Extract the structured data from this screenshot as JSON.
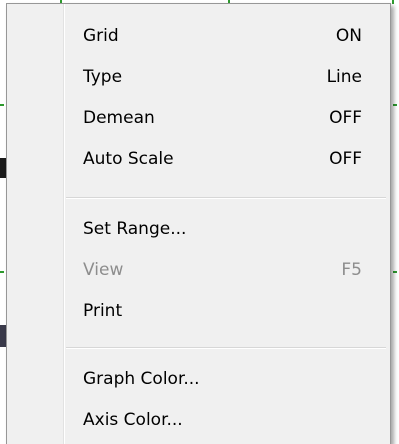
{
  "menu": {
    "items": [
      {
        "label": "Grid",
        "value": "ON",
        "enabled": true
      },
      {
        "label": "Type",
        "value": "Line",
        "enabled": true
      },
      {
        "label": "Demean",
        "value": "OFF",
        "enabled": true
      },
      {
        "label": "Auto Scale",
        "value": "OFF",
        "enabled": true
      },
      {
        "label": "Set Range...",
        "value": "",
        "enabled": true
      },
      {
        "label": "View",
        "value": "F5",
        "enabled": false
      },
      {
        "label": "Print",
        "value": "",
        "enabled": true
      },
      {
        "label": "Graph Color...",
        "value": "",
        "enabled": true
      },
      {
        "label": "Axis Color...",
        "value": "",
        "enabled": true
      }
    ]
  },
  "colors": {
    "menu_background": "#f0f0f0",
    "menu_border": "#979797",
    "disabled_text": "#8d8d8d",
    "graph_tick": "#2e9a2e"
  }
}
